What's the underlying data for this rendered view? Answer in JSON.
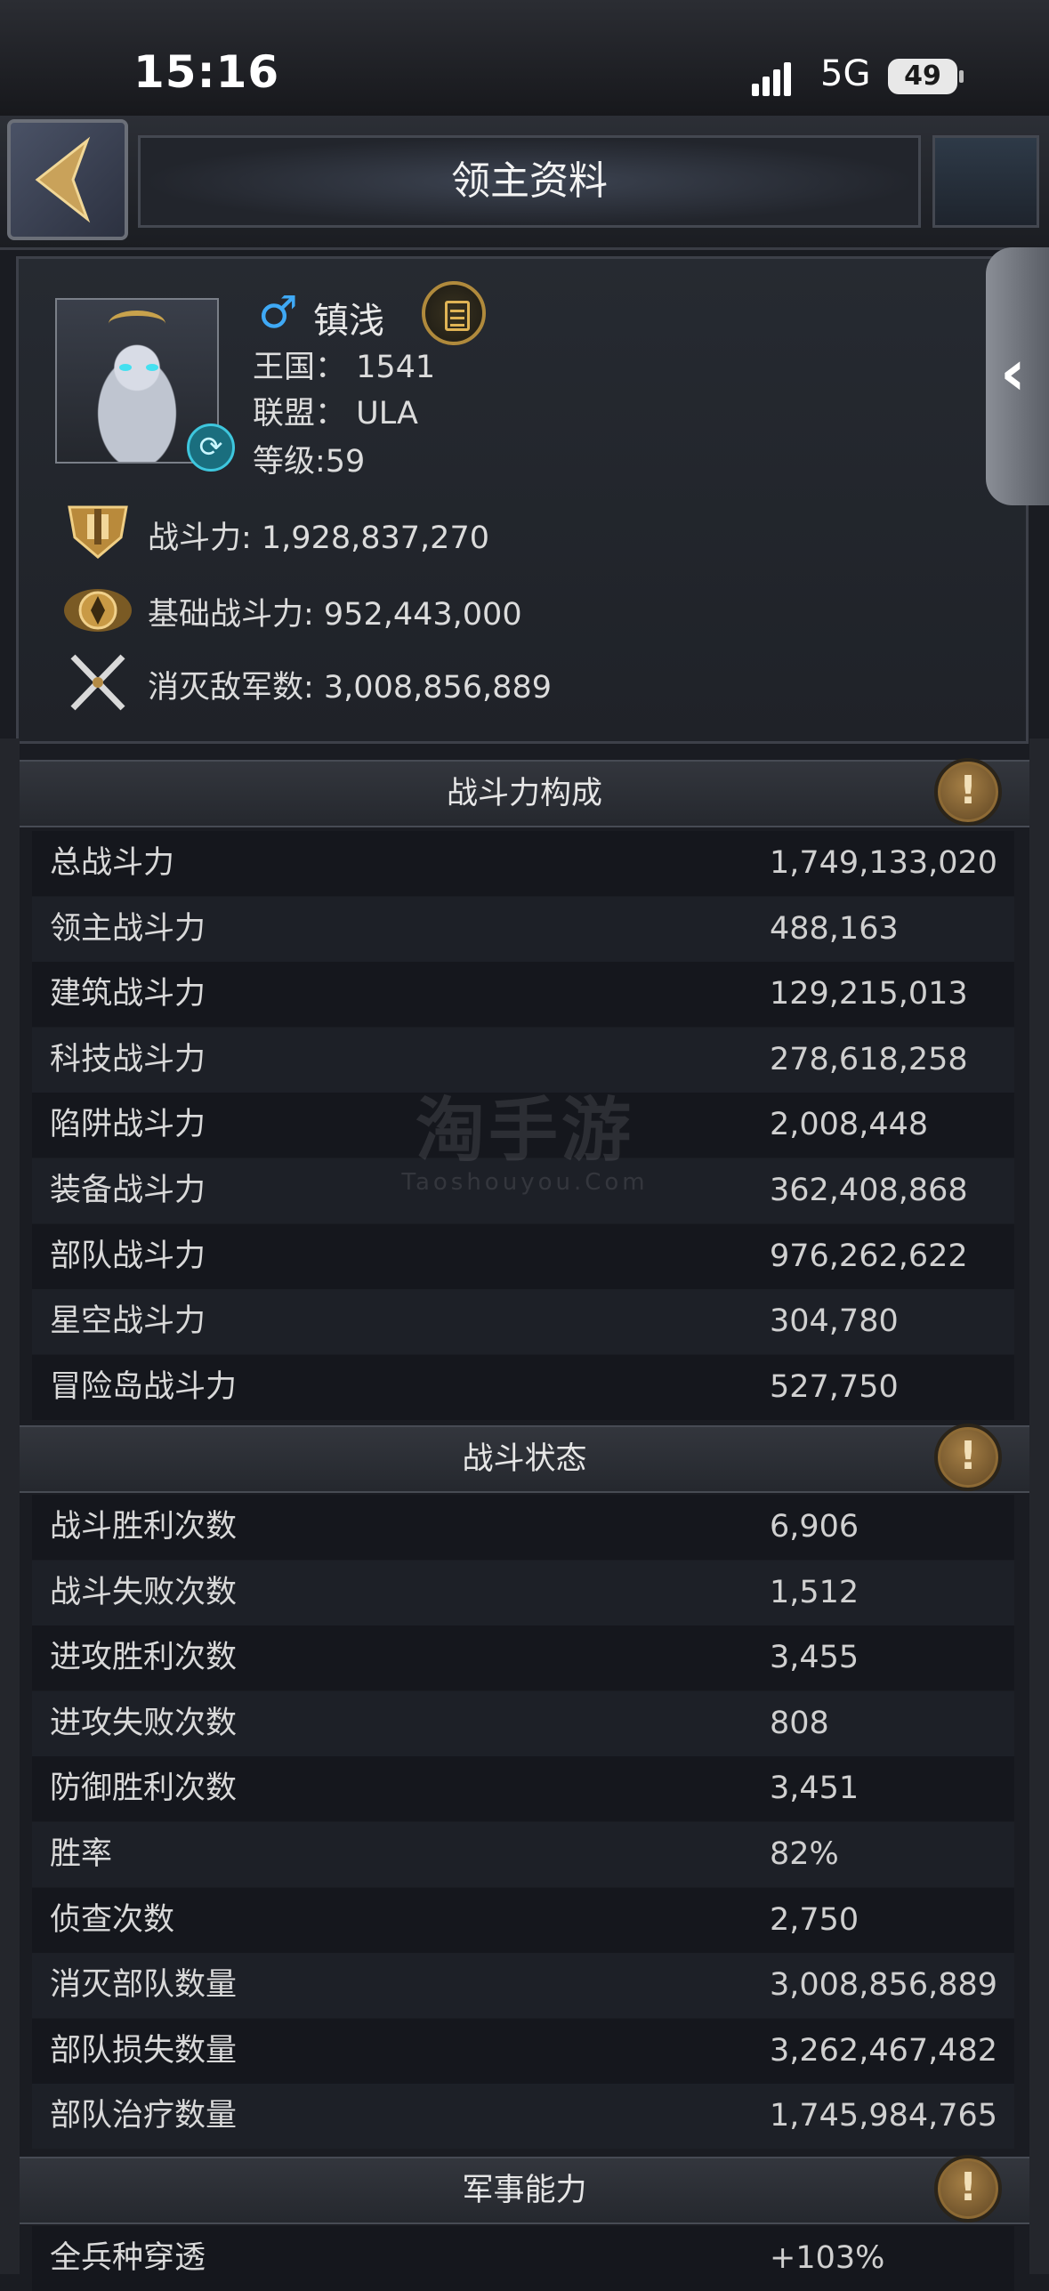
{
  "status_bar": {
    "time": "15:16",
    "network": "5G",
    "battery": "49"
  },
  "header": {
    "title": "领主资料"
  },
  "profile": {
    "gender_symbol": "♂",
    "name": "镇浅",
    "kingdom": "王国：  1541",
    "alliance": "联盟：  ULA",
    "level": "等级:59",
    "power": "战斗力: 1,928,837,270",
    "base_power": "基础战斗力: 952,443,000",
    "kills": "消灭敌军数: 3,008,856,889"
  },
  "sections": {
    "power_breakdown": {
      "title": "战斗力构成",
      "rows": [
        {
          "label": "总战斗力",
          "value": "1,749,133,020"
        },
        {
          "label": "领主战斗力",
          "value": "488,163"
        },
        {
          "label": "建筑战斗力",
          "value": "129,215,013"
        },
        {
          "label": "科技战斗力",
          "value": "278,618,258"
        },
        {
          "label": "陷阱战斗力",
          "value": "2,008,448"
        },
        {
          "label": "装备战斗力",
          "value": "362,408,868"
        },
        {
          "label": "部队战斗力",
          "value": "976,262,622"
        },
        {
          "label": "星空战斗力",
          "value": "304,780"
        },
        {
          "label": "冒险岛战斗力",
          "value": "527,750"
        }
      ]
    },
    "battle_status": {
      "title": "战斗状态",
      "rows": [
        {
          "label": "战斗胜利次数",
          "value": "6,906"
        },
        {
          "label": "战斗失败次数",
          "value": "1,512"
        },
        {
          "label": "进攻胜利次数",
          "value": "3,455"
        },
        {
          "label": "进攻失败次数",
          "value": "808"
        },
        {
          "label": "防御胜利次数",
          "value": "3,451"
        },
        {
          "label": "胜率",
          "value": "82%"
        },
        {
          "label": "侦查次数",
          "value": "2,750"
        },
        {
          "label": "消灭部队数量",
          "value": "3,008,856,889"
        },
        {
          "label": "部队损失数量",
          "value": "3,262,467,482"
        },
        {
          "label": "部队治疗数量",
          "value": "1,745,984,765"
        }
      ]
    },
    "military": {
      "title": "军事能力",
      "rows": [
        {
          "label": "全兵种穿透",
          "value": "+103%"
        }
      ]
    }
  },
  "watermark": {
    "big": "淘手游",
    "small": "Taoshouyou.Com"
  },
  "icons": {
    "back": "back-arrow-icon",
    "info": "exclamation-icon",
    "document": "document-icon",
    "refresh": "refresh-icon",
    "gender": "male-icon",
    "power": "shield-power-icon",
    "base_power": "winged-emblem-icon",
    "kills": "crossed-swords-icon"
  }
}
